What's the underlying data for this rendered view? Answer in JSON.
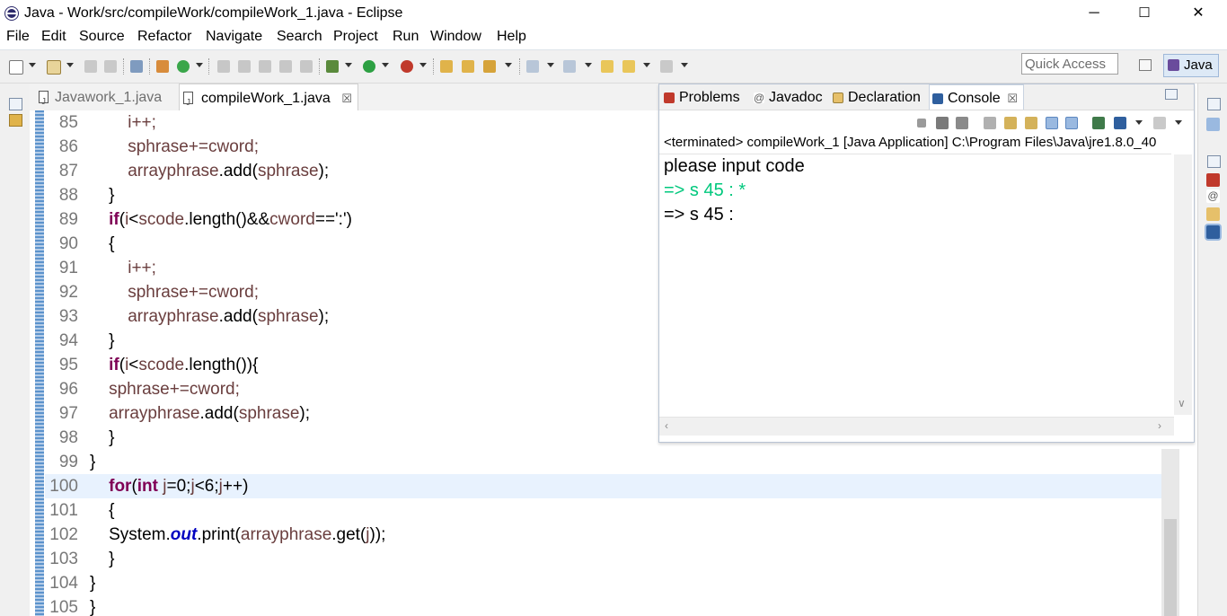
{
  "window": {
    "title": "Java - Work/src/compileWork/compileWork_1.java - Eclipse",
    "minimize": "─",
    "maximize": "☐",
    "close": "✕"
  },
  "menu": [
    "File",
    "Edit",
    "Source",
    "Refactor",
    "Navigate",
    "Search",
    "Project",
    "Run",
    "Window",
    "Help"
  ],
  "toolbar": {
    "quick_access": "Quick Access",
    "perspective": "Java"
  },
  "editor": {
    "tabs": [
      {
        "label": "Javawork_1.java",
        "active": false
      },
      {
        "label": "compileWork_1.java",
        "active": true,
        "close": "☒"
      }
    ],
    "lines": [
      {
        "n": "85",
        "tokens": [
          {
            "t": "        i++;",
            "c": "var"
          }
        ]
      },
      {
        "n": "86",
        "tokens": [
          {
            "t": "        sphrase+=cword;",
            "c": "var"
          }
        ]
      },
      {
        "n": "87",
        "tokens": [
          {
            "t": "        arrayphrase",
            "c": "var"
          },
          {
            "t": ".add(",
            "c": ""
          },
          {
            "t": "sphrase",
            "c": "var"
          },
          {
            "t": ");",
            "c": ""
          }
        ]
      },
      {
        "n": "88",
        "tokens": [
          {
            "t": "    }",
            "c": ""
          }
        ]
      },
      {
        "n": "89",
        "tokens": [
          {
            "t": "    ",
            "c": ""
          },
          {
            "t": "if",
            "c": "kw"
          },
          {
            "t": "(",
            "c": ""
          },
          {
            "t": "i",
            "c": "var"
          },
          {
            "t": "<",
            "c": ""
          },
          {
            "t": "scode",
            "c": "var"
          },
          {
            "t": ".length()&&",
            "c": ""
          },
          {
            "t": "cword",
            "c": "var"
          },
          {
            "t": "==':')",
            "c": ""
          }
        ]
      },
      {
        "n": "90",
        "tokens": [
          {
            "t": "    {",
            "c": ""
          }
        ]
      },
      {
        "n": "91",
        "tokens": [
          {
            "t": "        i++;",
            "c": "var"
          }
        ]
      },
      {
        "n": "92",
        "tokens": [
          {
            "t": "        sphrase+=cword;",
            "c": "var"
          }
        ]
      },
      {
        "n": "93",
        "tokens": [
          {
            "t": "        arrayphrase",
            "c": "var"
          },
          {
            "t": ".add(",
            "c": ""
          },
          {
            "t": "sphrase",
            "c": "var"
          },
          {
            "t": ");",
            "c": ""
          }
        ]
      },
      {
        "n": "94",
        "tokens": [
          {
            "t": "    }",
            "c": ""
          }
        ]
      },
      {
        "n": "95",
        "tokens": [
          {
            "t": "    ",
            "c": ""
          },
          {
            "t": "if",
            "c": "kw"
          },
          {
            "t": "(",
            "c": ""
          },
          {
            "t": "i",
            "c": "var"
          },
          {
            "t": "<",
            "c": ""
          },
          {
            "t": "scode",
            "c": "var"
          },
          {
            "t": ".length()){",
            "c": ""
          }
        ]
      },
      {
        "n": "96",
        "tokens": [
          {
            "t": "    sphrase+=cword;",
            "c": "var"
          }
        ]
      },
      {
        "n": "97",
        "tokens": [
          {
            "t": "    arrayphrase",
            "c": "var"
          },
          {
            "t": ".add(",
            "c": ""
          },
          {
            "t": "sphrase",
            "c": "var"
          },
          {
            "t": ");",
            "c": ""
          }
        ]
      },
      {
        "n": "98",
        "tokens": [
          {
            "t": "    }",
            "c": ""
          }
        ]
      },
      {
        "n": "99",
        "tokens": [
          {
            "t": "}",
            "c": ""
          }
        ]
      },
      {
        "n": "100",
        "cur": true,
        "tokens": [
          {
            "t": "    ",
            "c": ""
          },
          {
            "t": "for",
            "c": "kw"
          },
          {
            "t": "(",
            "c": ""
          },
          {
            "t": "int",
            "c": "kw"
          },
          {
            "t": " j",
            "c": "var"
          },
          {
            "t": "=0;",
            "c": ""
          },
          {
            "t": "j",
            "c": "var"
          },
          {
            "t": "<6;",
            "c": ""
          },
          {
            "t": "j",
            "c": "var"
          },
          {
            "t": "++)",
            "c": ""
          }
        ]
      },
      {
        "n": "101",
        "tokens": [
          {
            "t": "    {",
            "c": ""
          }
        ]
      },
      {
        "n": "102",
        "tokens": [
          {
            "t": "    System.",
            "c": ""
          },
          {
            "t": "out",
            "c": "st"
          },
          {
            "t": ".print(",
            "c": ""
          },
          {
            "t": "arrayphrase",
            "c": "var"
          },
          {
            "t": ".get(",
            "c": ""
          },
          {
            "t": "j",
            "c": "var"
          },
          {
            "t": "));",
            "c": ""
          }
        ]
      },
      {
        "n": "103",
        "tokens": [
          {
            "t": "    }",
            "c": ""
          }
        ]
      },
      {
        "n": "104",
        "tokens": [
          {
            "t": "}",
            "c": ""
          }
        ]
      },
      {
        "n": "105",
        "tokens": [
          {
            "t": "}",
            "c": ""
          }
        ]
      }
    ]
  },
  "console": {
    "tabs": [
      {
        "label": "Problems",
        "icon": "problems-icon",
        "color": "#c0392b"
      },
      {
        "label": "Javadoc",
        "icon": "javadoc-icon",
        "color": "#7f7f7f"
      },
      {
        "label": "Declaration",
        "icon": "declaration-icon",
        "color": "#c28c2b"
      },
      {
        "label": "Console",
        "icon": "console-icon",
        "color": "#2f5f9e",
        "active": true,
        "close": "☒"
      }
    ],
    "status": "<terminated> compileWork_1 [Java Application] C:\\Program Files\\Java\\jre1.8.0_40",
    "output": [
      {
        "text": "please input code",
        "type": "out"
      },
      {
        "text": "=> s 45 : *",
        "type": "in"
      },
      {
        "text": "=> s 45 :",
        "type": "out"
      }
    ]
  }
}
